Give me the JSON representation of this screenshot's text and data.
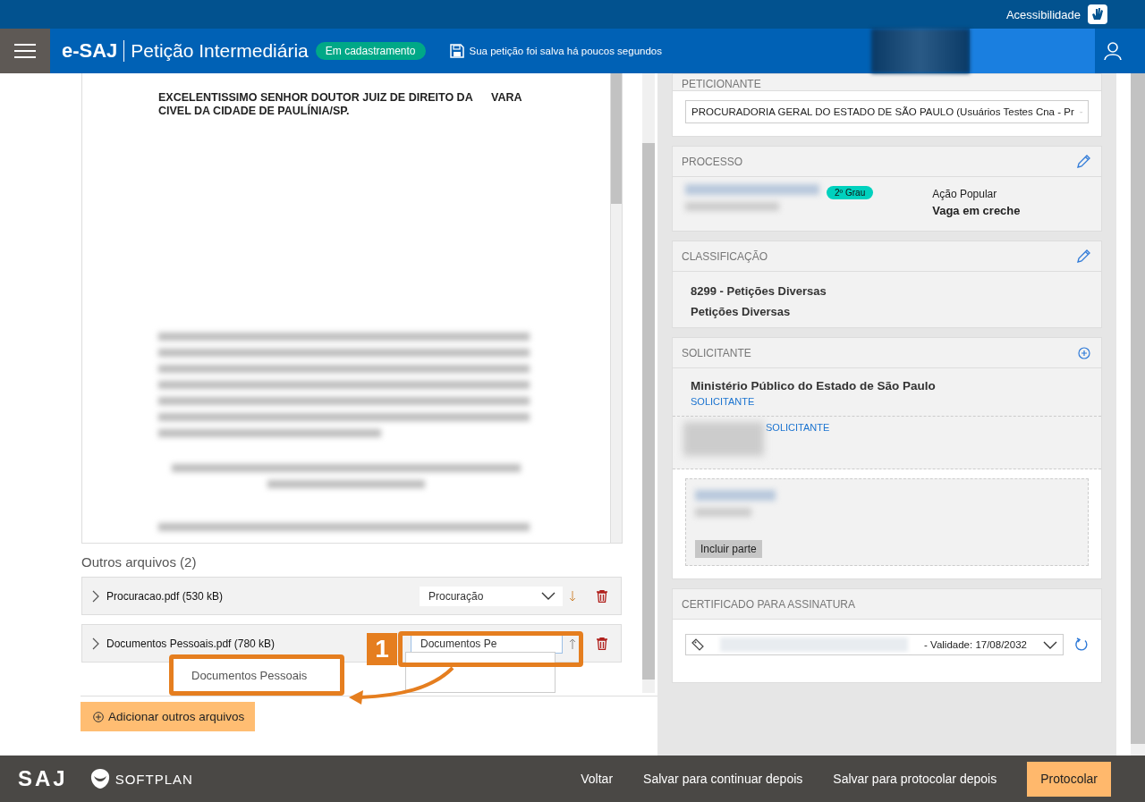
{
  "top_bar": {
    "accessibility_label": "Acessibilidade"
  },
  "header": {
    "brand": "e-SAJ",
    "title": "Petição Intermediária",
    "status_badge": "Em cadastramento",
    "save_status": "Sua petição foi salva há poucos segundos"
  },
  "document": {
    "heading_lines": [
      "EXCELENTISSIMO SENHOR DOUTOR JUIZ DE DIREITO DA      VARA",
      "CIVEL DA CIDADE DE PAULÍNIA/SP."
    ]
  },
  "other_files": {
    "title": "Outros arquivos (2)",
    "files": [
      {
        "name": "Procuracao.pdf (530 kB)",
        "kind": "select",
        "type_value": "Procuração",
        "move_down": true
      },
      {
        "name": "Documentos Pessoais.pdf (780 kB)",
        "kind": "autocomplete",
        "type_value": "Documentos Pe",
        "move_down": false,
        "suggestion": "Documentos Pessoais"
      }
    ],
    "add_button": "Adicionar outros arquivos"
  },
  "annotation": {
    "step": "1"
  },
  "sidebar": {
    "peticionante": {
      "title": "PETICIONANTE",
      "value": "PROCURADORIA GERAL DO ESTADO DE SÃO PAULO (Usuários Testes Cna - Pr"
    },
    "processo": {
      "title": "PROCESSO",
      "badge": "2º Grau",
      "class": "Ação Popular",
      "subject": "Vaga em creche"
    },
    "classificacao": {
      "title": "CLASSIFICAÇÃO",
      "lines": [
        "8299 - Petições Diversas",
        "Petições Diversas"
      ]
    },
    "solicitante": {
      "title": "SOLICITANTE",
      "parties": [
        {
          "kind": "named",
          "name": "Ministério Público do Estado de São Paulo",
          "role": "SOLICITANTE"
        },
        {
          "kind": "redacted",
          "role": "SOLICITANTE"
        }
      ],
      "include_button": "Incluir parte"
    },
    "certificado": {
      "title": "CERTIFICADO PARA ASSINATURA",
      "value": "- Validade: 17/08/2032"
    }
  },
  "footer": {
    "logos": [
      "SAJ",
      "SOFTPLAN"
    ],
    "buttons": [
      {
        "label": "Voltar",
        "kind": "link"
      },
      {
        "label": "Salvar para continuar depois",
        "kind": "link"
      },
      {
        "label": "Salvar para protocolar depois",
        "kind": "link"
      },
      {
        "label": "Protocolar",
        "kind": "primary"
      }
    ]
  }
}
